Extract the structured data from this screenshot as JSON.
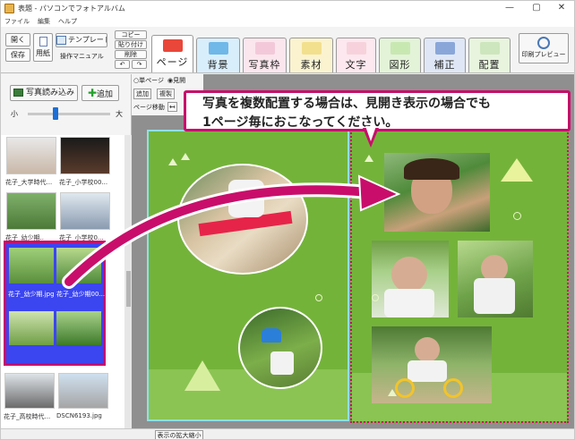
{
  "window": {
    "title": "表題 - パソコンでフォトアルバム",
    "controls": [
      "—",
      "▢",
      "✕"
    ]
  },
  "menu": [
    "ファイル",
    "編集",
    "ヘルプ"
  ],
  "toolbar": {
    "open": "開く",
    "save": "保存",
    "paper": "用紙",
    "template": "テンプレート",
    "manual": "操作マニュアル",
    "copy": "コピー",
    "paste": "貼り付け",
    "delete": "削除",
    "preview": "印刷プレビュー"
  },
  "tabs": [
    {
      "label": "ページ",
      "color": "#e9473a"
    },
    {
      "label": "背景",
      "color": "#6fb8e8"
    },
    {
      "label": "写真枠",
      "color": "#f3c9d9"
    },
    {
      "label": "素材",
      "color": "#f3e08e"
    },
    {
      "label": "文字",
      "color": "#f7d2dc"
    },
    {
      "label": "図形",
      "color": "#c8e8b2"
    },
    {
      "label": "補正",
      "color": "#8aa6d9"
    },
    {
      "label": "配置",
      "color": "#cde6bd"
    }
  ],
  "left_panel": {
    "load_photo": "写真読み込み",
    "add": "追加",
    "slider_min": "小",
    "slider_max": "大",
    "thumbnails": [
      {
        "caption": "花子_大学時代..."
      },
      {
        "caption": "花子_小学校00..."
      },
      {
        "caption": "花子_幼少期.."
      },
      {
        "caption": "花子_小学校0..."
      },
      {
        "caption": "花子_幼少期.jpg"
      },
      {
        "caption": "花子_幼少期00..."
      },
      {
        "caption": "花子_高校時代..."
      },
      {
        "caption": "DSCN6193.jpg"
      }
    ]
  },
  "page_options": {
    "single": "単ページ",
    "spread": "見開",
    "add": "追加",
    "duplicate": "複製",
    "move": "ページ移動"
  },
  "callout": {
    "line1": "写真を複数配置する場合は、見開き表示の場合でも",
    "line2": "1ページ毎におこなってください。"
  },
  "status": {
    "zoom_button": "表示の拡大縮小"
  },
  "colors": {
    "accent": "#c80e6a",
    "page_green": "#74b33a",
    "selection_blue": "#3b45f0"
  }
}
